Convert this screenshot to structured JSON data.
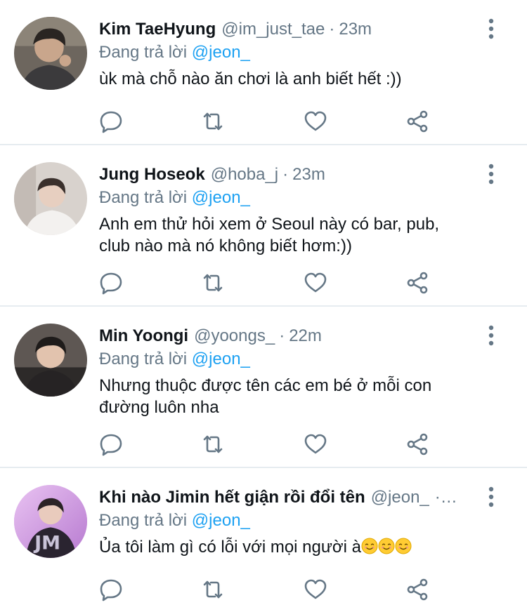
{
  "tweets": [
    {
      "name": "Kim TaeHyung",
      "handle": "@im_just_tae",
      "time": "23m",
      "replying_label": "Đang trả lời",
      "replying_to": "@jeon_",
      "text": "ùk mà chỗ nào ăn chơi là anh biết hết :))"
    },
    {
      "name": "Jung Hoseok",
      "handle": "@hoba_j",
      "time": "23m",
      "replying_label": "Đang trả lời",
      "replying_to": "@jeon_",
      "text": "Anh em thử hỏi xem ở Seoul này có bar, pub, club nào mà nó không biết hơm:))"
    },
    {
      "name": "Min Yoongi",
      "handle": "@yoongs_",
      "time": "22m",
      "replying_label": "Đang trả lời",
      "replying_to": "@jeon_",
      "text": "Nhưng thuộc được tên các em bé ở mỗi con đường luôn nha"
    },
    {
      "name": "Khi nào Jimin hết giận rồi đổi tên",
      "handle": "@jeon_",
      "time": "·…",
      "replying_label": "Đang trả lời",
      "replying_to": "@jeon_",
      "text": "Ủa tôi làm gì có lỗi với mọi người à",
      "emoji": [
        "smiling-face",
        "smiling-face",
        "smiling-face"
      ]
    }
  ],
  "colors": {
    "link": "#1da1f2",
    "secondary_text": "#657786",
    "icon": "#657786",
    "divider": "#e6ecf0"
  },
  "icons": [
    "reply-icon",
    "retweet-icon",
    "like-icon",
    "share-icon",
    "more-options-icon"
  ]
}
